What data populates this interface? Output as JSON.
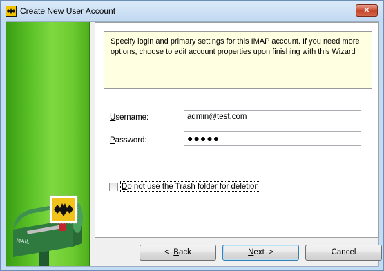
{
  "window": {
    "title": "Create New User Account",
    "close_glyph": "✕"
  },
  "info": {
    "text": "Specify login and primary settings for this IMAP account. If you need more options, choose to edit account properties upon finishing with this Wizard"
  },
  "form": {
    "username": {
      "label_mnemonic": "U",
      "label_rest": "sername:",
      "value": "admin@test.com"
    },
    "password": {
      "label_mnemonic": "P",
      "label_rest": "assword:",
      "value_masked": "●●●●●"
    },
    "trash_option": {
      "mnemonic": "D",
      "rest": "o not use the Trash folder for deletion",
      "checked": false
    }
  },
  "buttons": {
    "back": {
      "prefix": "<  ",
      "mnemonic": "B",
      "rest": "ack"
    },
    "next": {
      "mnemonic": "N",
      "rest": "ext",
      "suffix": "  >"
    },
    "cancel": {
      "label": "Cancel"
    }
  },
  "side_panel": {
    "mailbox_text": "MAIL",
    "icons": [
      "bat-stamp-icon",
      "mailbox-icon"
    ]
  },
  "colors": {
    "side_green": "#5cc228",
    "info_bg": "#ffffe1",
    "default_button_border": "#3c7fb1"
  }
}
